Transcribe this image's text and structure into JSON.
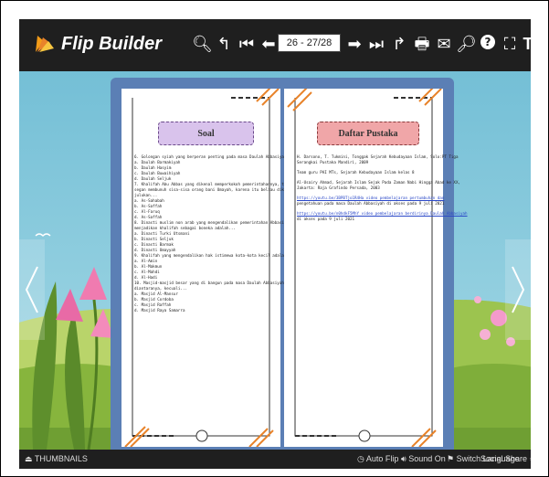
{
  "app": {
    "title": "Flip Builder"
  },
  "toolbar": {
    "page_indicator": "26 - 27/28"
  },
  "left_page": {
    "heading": "Soal",
    "lines": [
      "6. Golongan syiah yang berperan penting pada masa Daulah Abbasiyah yaitu...",
      "   a. Daulah Barmakiyah",
      "   b. Daulah Hasyim",
      "   c. Daulah Buwaihiyah",
      "   d. Daulah Seljuk",
      "7. Khalifah Abu Abbas yang dikenal memperkokoh pemerintahannya, tidak segan-",
      "   segan membunuh sisa-sisa orang bani Umayah, karena itu beliau dikenal",
      "   julukan...",
      "   a. As-Sahabah",
      "   b. As-Saffah",
      "   c. Al-Faruq",
      "   d. As-Saffah",
      "8. Dinasti muslim non arab yang mengendalikan pemerintahan Abbasiyah dan",
      "   menjadikan khalifah sebagai boneka adalah...",
      "   a. Dinasti Turki Utsmani",
      "   b. Dinasti Seljuk",
      "   c. Dinasti Barmak",
      "   d. Dinasti Umayyah",
      "9. Khalifah yang mengendalikan hak istimewa kota-kota kecil adalah...",
      "   a. Al-Amin",
      "   b. Al-Makmun",
      "   c. Al-Mahdi",
      "   d. Al-Hadi",
      "10. Masjid-masjid besar yang di bangun pada masa Daulah Abbasiyah",
      "   diantaranya, kecuali...",
      "   a. Masjid Al-Mansur",
      "   b. Masjid Cordoba",
      "   c. Masjid Raffah",
      "   d. Masjid Raya Samarra"
    ]
  },
  "right_page": {
    "heading": "Daftar Pustaka",
    "refs": [
      {
        "lines": [
          "H. Darsono, T. Tukmini, Tonggak Sejarah Kebudayaan Islam, Solo:PT Tiga",
          "   Serangkai Pustaka Mandiri, 2009"
        ],
        "link": false
      },
      {
        "lines": [
          "Team guru PAI MTs, Sejarah Kebudayaan Islam kelas 8"
        ],
        "link": false
      },
      {
        "lines": [
          "Al-Usairy Ahmad, Sejarah Islam Sejak Pada Zaman Nabi Hingga Abad ke XX,",
          "   Jakarta: Raja Grafindo Persada, 2003"
        ],
        "link": false
      },
      {
        "lines": [
          "https://youtu.be/3BPBTjo1R4Ha  video pembelajaran pertumbuhan dan",
          "   pengetahuan pada masa Daulah Abbasiyah di akses pada 9 juli 2021"
        ],
        "link": true
      },
      {
        "lines": [
          "https://youtu.be/n0hdkF5MhY  video pembelajaran berdirinya Daulah Abbasiyah",
          "   di akses pada 9 juli 2021"
        ],
        "link": true
      }
    ]
  },
  "bottombar": {
    "thumbnails": "THUMBNAILS",
    "auto_flip": "Auto Flip",
    "sound": "Sound On",
    "switch_language": "Switch Language",
    "social_share": "Social Share"
  },
  "colors": {
    "toolbar": "#1f1f1f",
    "book_cover": "#5b7fb5",
    "left_heading": "#d9c3ec",
    "right_heading": "#f0a6a8",
    "accent_orange": "#e8832a"
  }
}
